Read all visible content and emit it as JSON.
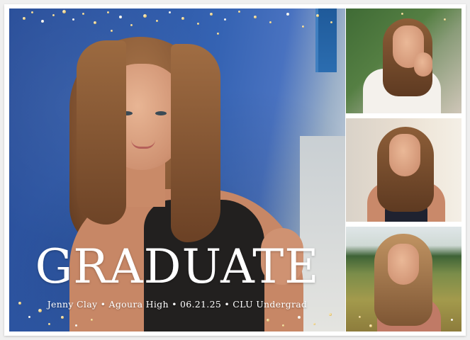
{
  "card": {
    "headline": "GRADUATE",
    "details": "Jenny Clay • Agoura High • 06.21.25 • CLU Undergrad"
  },
  "colors": {
    "headline_text": "#ffffff",
    "confetti_gold": "#e6c97a",
    "card_background": "#ffffff"
  }
}
